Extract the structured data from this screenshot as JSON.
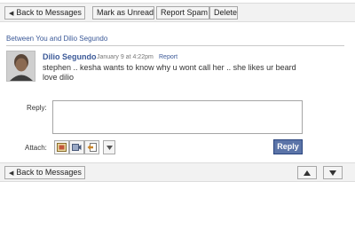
{
  "toolbar": {
    "back_label": "Back to Messages",
    "mark_unread_label": "Mark as Unread",
    "report_spam_label": "Report Spam",
    "delete_label": "Delete"
  },
  "thread": {
    "between_text": "Between You and Dilio Segundo"
  },
  "message": {
    "sender": "Dilio Segundo",
    "date": "January 9 at 4:22pm",
    "report_label": "Report",
    "lines": [
      "stephen .. kesha wants to know why u wont call her .. she likes ur beard",
      "love dilio"
    ]
  },
  "reply": {
    "label": "Reply:",
    "value": "",
    "attach_label": "Attach:",
    "button_label": "Reply"
  },
  "bottom": {
    "back_label": "Back to Messages"
  },
  "icons": {
    "back": "left-triangle-icon",
    "attach_photo": "photo-icon",
    "attach_video": "video-icon",
    "attach_share": "share-icon",
    "more": "chevron-down-icon",
    "prev": "up-triangle-icon",
    "next": "down-triangle-icon"
  },
  "colors": {
    "link": "#3b5998",
    "reply_button": "#5b74a8"
  }
}
